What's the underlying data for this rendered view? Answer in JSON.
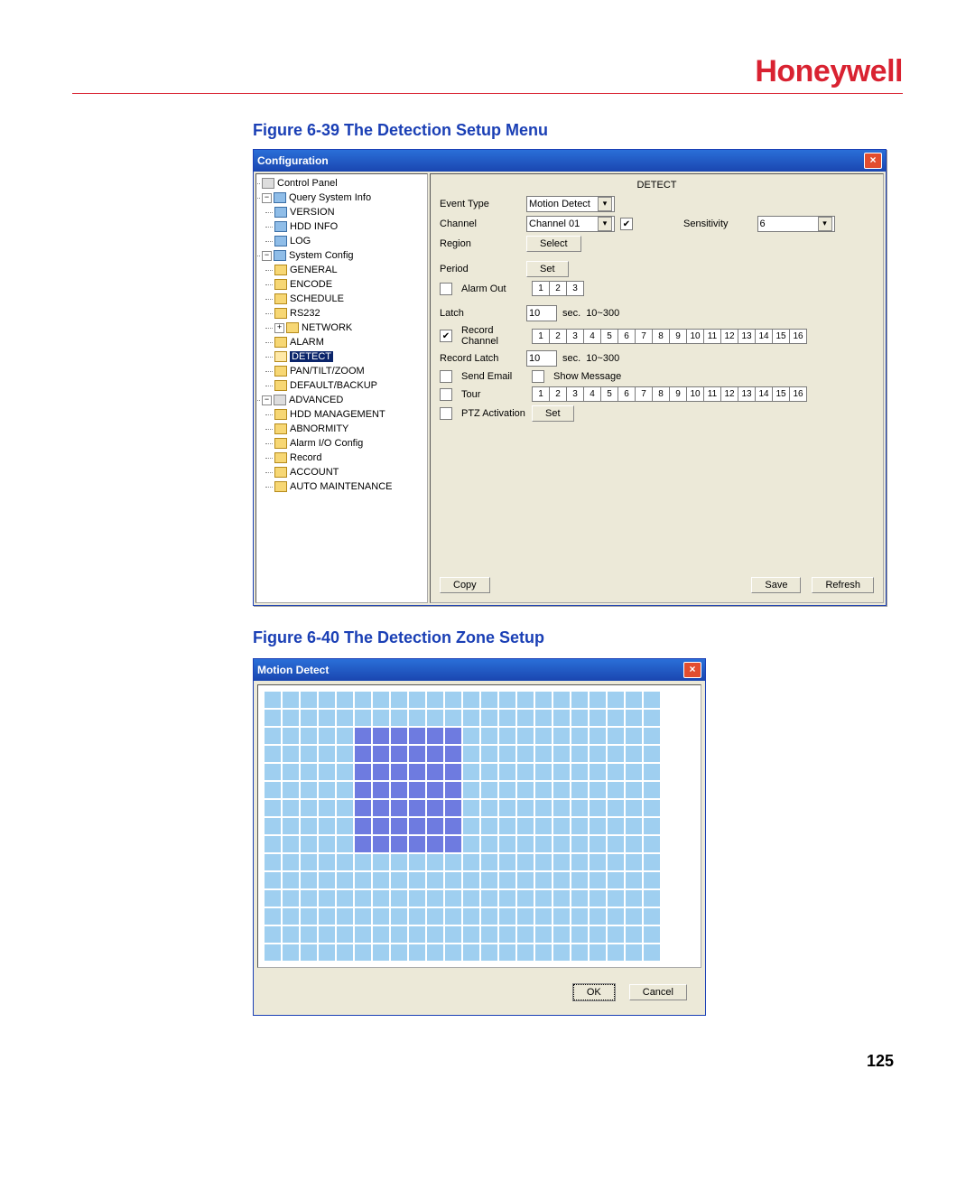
{
  "brand": "Honeywell",
  "page_number": "125",
  "figures": {
    "f1": "Figure 6-39 The Detection Setup Menu",
    "f2": "Figure 6-40 The Detection Zone Setup"
  },
  "config_window": {
    "title": "Configuration",
    "tree": {
      "root": "Control Panel",
      "query_info": "Query System Info",
      "version": "VERSION",
      "hdd_info": "HDD INFO",
      "log": "LOG",
      "system_config": "System Config",
      "general": "GENERAL",
      "encode": "ENCODE",
      "schedule": "SCHEDULE",
      "rs232": "RS232",
      "network": "NETWORK",
      "alarm": "ALARM",
      "detect": "DETECT",
      "ptz": "PAN/TILT/ZOOM",
      "default": "DEFAULT/BACKUP",
      "advanced": "ADVANCED",
      "hdd_mgmt": "HDD MANAGEMENT",
      "abnormity": "ABNORMITY",
      "alarm_io": "Alarm I/O Config",
      "record": "Record",
      "account": "ACCOUNT",
      "auto_maint": "AUTO MAINTENANCE"
    },
    "panel": {
      "title": "DETECT",
      "event_type_label": "Event Type",
      "event_type_value": "Motion Detect",
      "channel_label": "Channel",
      "channel_value": "Channel 01",
      "sensitivity_label": "Sensitivity",
      "sensitivity_value": "6",
      "region_label": "Region",
      "region_btn": "Select",
      "period_label": "Period",
      "period_btn": "Set",
      "alarm_out_label": "Alarm Out",
      "alarm_out_values": [
        "1",
        "2",
        "3"
      ],
      "latch_label": "Latch",
      "latch_value": "10",
      "latch_unit": "sec.",
      "latch_range": "10~300",
      "record_channel_label": "Record Channel",
      "record_channels": [
        "1",
        "2",
        "3",
        "4",
        "5",
        "6",
        "7",
        "8",
        "9",
        "10",
        "11",
        "12",
        "13",
        "14",
        "15",
        "16"
      ],
      "record_latch_label": "Record Latch",
      "record_latch_value": "10",
      "send_email_label": "Send Email",
      "show_message_label": "Show Message",
      "tour_label": "Tour",
      "tour_channels": [
        "1",
        "2",
        "3",
        "4",
        "5",
        "6",
        "7",
        "8",
        "9",
        "10",
        "11",
        "12",
        "13",
        "14",
        "15",
        "16"
      ],
      "ptz_activation_label": "PTZ Activation",
      "ptz_btn": "Set",
      "copy_btn": "Copy",
      "save_btn": "Save",
      "refresh_btn": "Refresh"
    }
  },
  "motion_window": {
    "title": "Motion Detect",
    "ok_btn": "OK",
    "cancel_btn": "Cancel",
    "grid": {
      "rows": 15,
      "cols": 22,
      "selected_region": {
        "row_start": 2,
        "row_end": 8,
        "col_start": 5,
        "col_end": 10
      }
    }
  }
}
